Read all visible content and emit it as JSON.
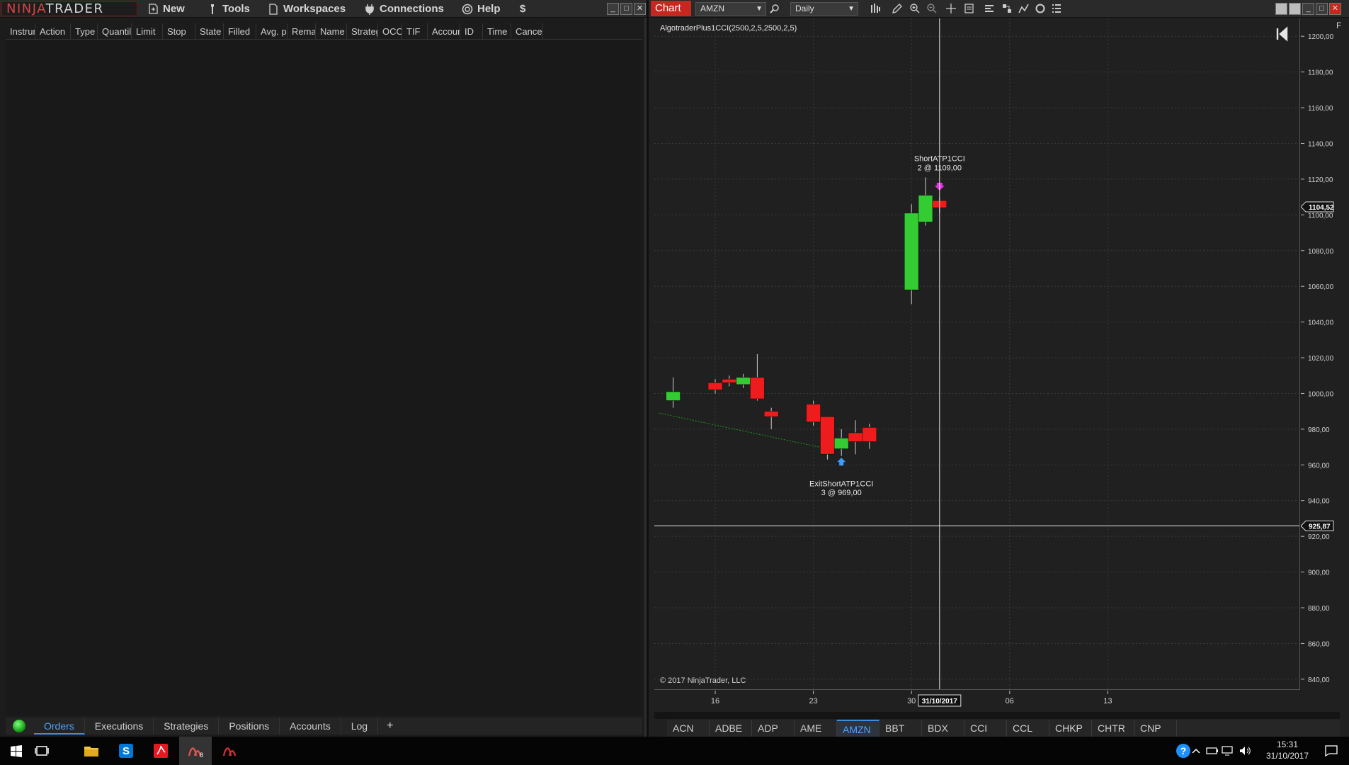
{
  "app": {
    "logo_part1": "NINJA",
    "logo_part2": "TRADER"
  },
  "menu": {
    "new": "New",
    "tools": "Tools",
    "workspaces": "Workspaces",
    "connections": "Connections",
    "help": "Help",
    "dollar": "$"
  },
  "orders_columns": [
    "Instrun",
    "Action",
    "Type",
    "Quantil",
    "Limit",
    "Stop",
    "State",
    "Filled",
    "Avg. pri",
    "Remai",
    "Name",
    "Strateg",
    "OCO",
    "TIF",
    "Accour",
    "ID",
    "Time",
    "Cance"
  ],
  "cc_tabs": [
    "Orders",
    "Executions",
    "Strategies",
    "Positions",
    "Accounts",
    "Log"
  ],
  "cc_add": "+",
  "chart_window": {
    "label": "Chart",
    "instrument": "AMZN",
    "interval": "Daily",
    "indicator": "AlgotraderPlus1CCI(2500,2,5,2500,2,5)",
    "copyright": "© 2017 NinjaTrader, LLC",
    "corner_letter": "F",
    "short_label": "ShortATP1CCI",
    "short_detail": "2 @ 1109,00",
    "exit_label": "ExitShortATP1CCI",
    "exit_detail": "3 @ 969,00",
    "crosshair_price": "925,87",
    "last_price": "1104,52",
    "crosshair_date": "31/10/2017"
  },
  "instrument_tabs": [
    "ACN",
    "ADBE",
    "ADP",
    "AME",
    "AMZN",
    "BBT",
    "BDX",
    "CCI",
    "CCL",
    "CHKP",
    "CHTR",
    "CNP"
  ],
  "active_instrument": "AMZN",
  "taskbar": {
    "time": "15:31",
    "date": "31/10/2017"
  },
  "colors": {
    "up": "#33cc33",
    "down": "#ee1c1c",
    "accent": "#c6281f",
    "tab_active": "#4da3ff"
  },
  "chart_data": {
    "type": "candlestick",
    "y_ticks": [
      840,
      860,
      880,
      900,
      920,
      940,
      960,
      980,
      1000,
      1020,
      1040,
      1060,
      1080,
      1100,
      1120,
      1140,
      1160,
      1180,
      1200
    ],
    "ylim": [
      834,
      1210
    ],
    "x_tick_labels": [
      "16",
      "23",
      "30",
      "06",
      "13"
    ],
    "candles": [
      {
        "d": "2017-10-13",
        "o": 996,
        "h": 1009,
        "l": 992,
        "c": 1001
      },
      {
        "d": "2017-10-16",
        "o": 1006,
        "h": 1008,
        "l": 1000,
        "c": 1002
      },
      {
        "d": "2017-10-17",
        "o": 1008,
        "h": 1010,
        "l": 1004,
        "c": 1006
      },
      {
        "d": "2017-10-18",
        "o": 1005,
        "h": 1011,
        "l": 1003,
        "c": 1009
      },
      {
        "d": "2017-10-19",
        "o": 1009,
        "h": 1022,
        "l": 996,
        "c": 997
      },
      {
        "d": "2017-10-20",
        "o": 990,
        "h": 992,
        "l": 980,
        "c": 987
      },
      {
        "d": "2017-10-23",
        "o": 994,
        "h": 996,
        "l": 982,
        "c": 984
      },
      {
        "d": "2017-10-24",
        "o": 987,
        "h": 987,
        "l": 963,
        "c": 966
      },
      {
        "d": "2017-10-25",
        "o": 969,
        "h": 980,
        "l": 965,
        "c": 975
      },
      {
        "d": "2017-10-26",
        "o": 978,
        "h": 985,
        "l": 966,
        "c": 973
      },
      {
        "d": "2017-10-27",
        "o": 981,
        "h": 983,
        "l": 969,
        "c": 973
      },
      {
        "d": "2017-10-30",
        "o": 1058,
        "h": 1106,
        "l": 1050,
        "c": 1101
      },
      {
        "d": "2017-10-31",
        "o": 1096,
        "h": 1121,
        "l": 1094,
        "c": 1111
      },
      {
        "d": "2017-11-01",
        "o": 1108,
        "h": 1110,
        "l": 1101,
        "c": 1104
      }
    ],
    "trendline": {
      "from": {
        "d": "2017-10-12",
        "v": 989
      },
      "to": {
        "d": "2017-10-24",
        "v": 969
      }
    },
    "markers": [
      {
        "name": "ShortATP1CCI",
        "d": "2017-11-01",
        "price": 1109,
        "qty": 2,
        "direction": "down"
      },
      {
        "name": "ExitShortATP1CCI",
        "d": "2017-10-25",
        "price": 969,
        "qty": 3,
        "direction": "up"
      }
    ],
    "crosshair": {
      "d": "2017-11-01",
      "v": 925.87
    },
    "last_price": 1104.52
  }
}
